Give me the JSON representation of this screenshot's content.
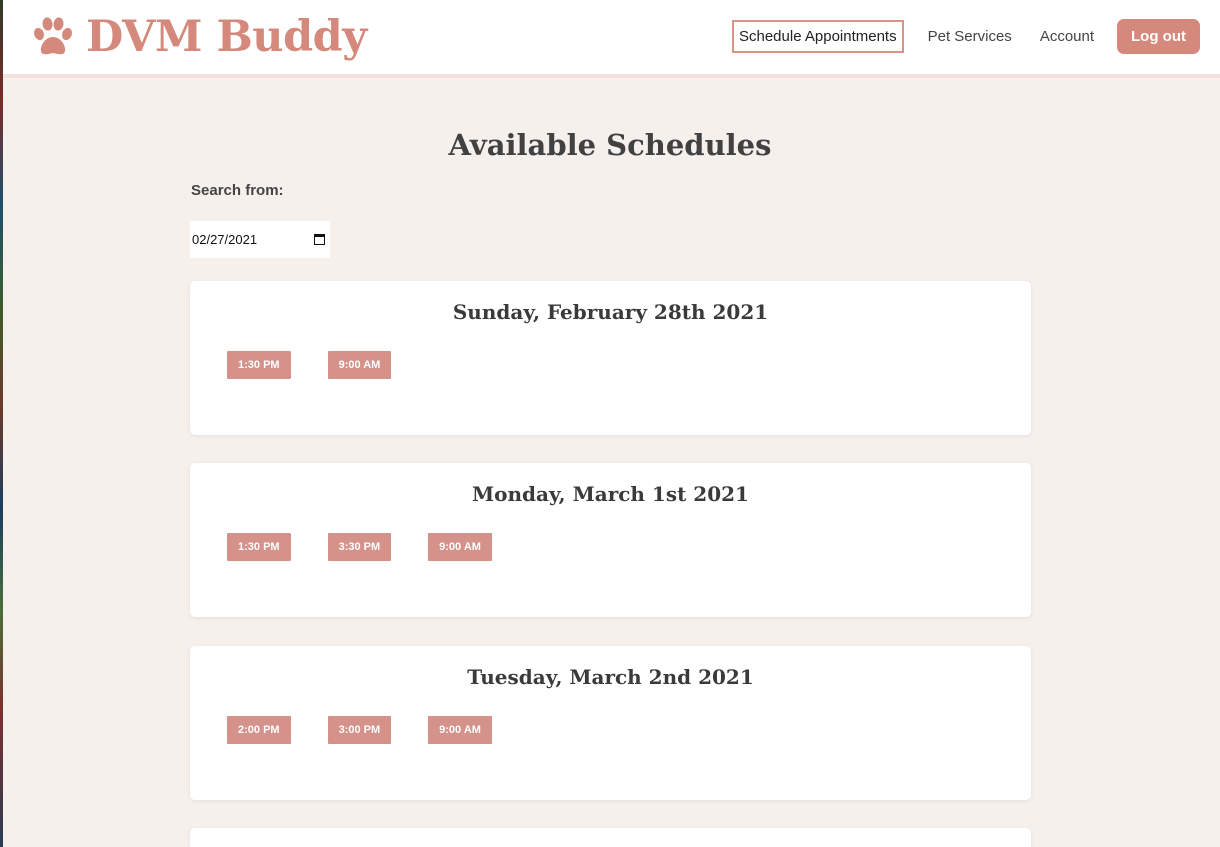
{
  "app": {
    "brand_name": "DVM Buddy",
    "brand_icon": "paw-icon",
    "accent_color": "#d4897c"
  },
  "nav": {
    "items": [
      {
        "label": "Schedule Appointments",
        "active": true
      },
      {
        "label": "Pet Services",
        "active": false
      },
      {
        "label": "Account",
        "active": false
      }
    ],
    "logout_label": "Log out"
  },
  "main": {
    "title": "Available Schedules",
    "search_label": "Search from:",
    "search_date": "02/27/2021",
    "days": [
      {
        "date": "Sunday, February 28th 2021",
        "slots": [
          "1:30 PM",
          "9:00 AM"
        ]
      },
      {
        "date": "Monday, March 1st 2021",
        "slots": [
          "1:30 PM",
          "3:30 PM",
          "9:00 AM"
        ]
      },
      {
        "date": "Tuesday, March 2nd 2021",
        "slots": [
          "2:00 PM",
          "3:00 PM",
          "9:00 AM"
        ]
      },
      {
        "date": "",
        "slots": []
      }
    ]
  }
}
